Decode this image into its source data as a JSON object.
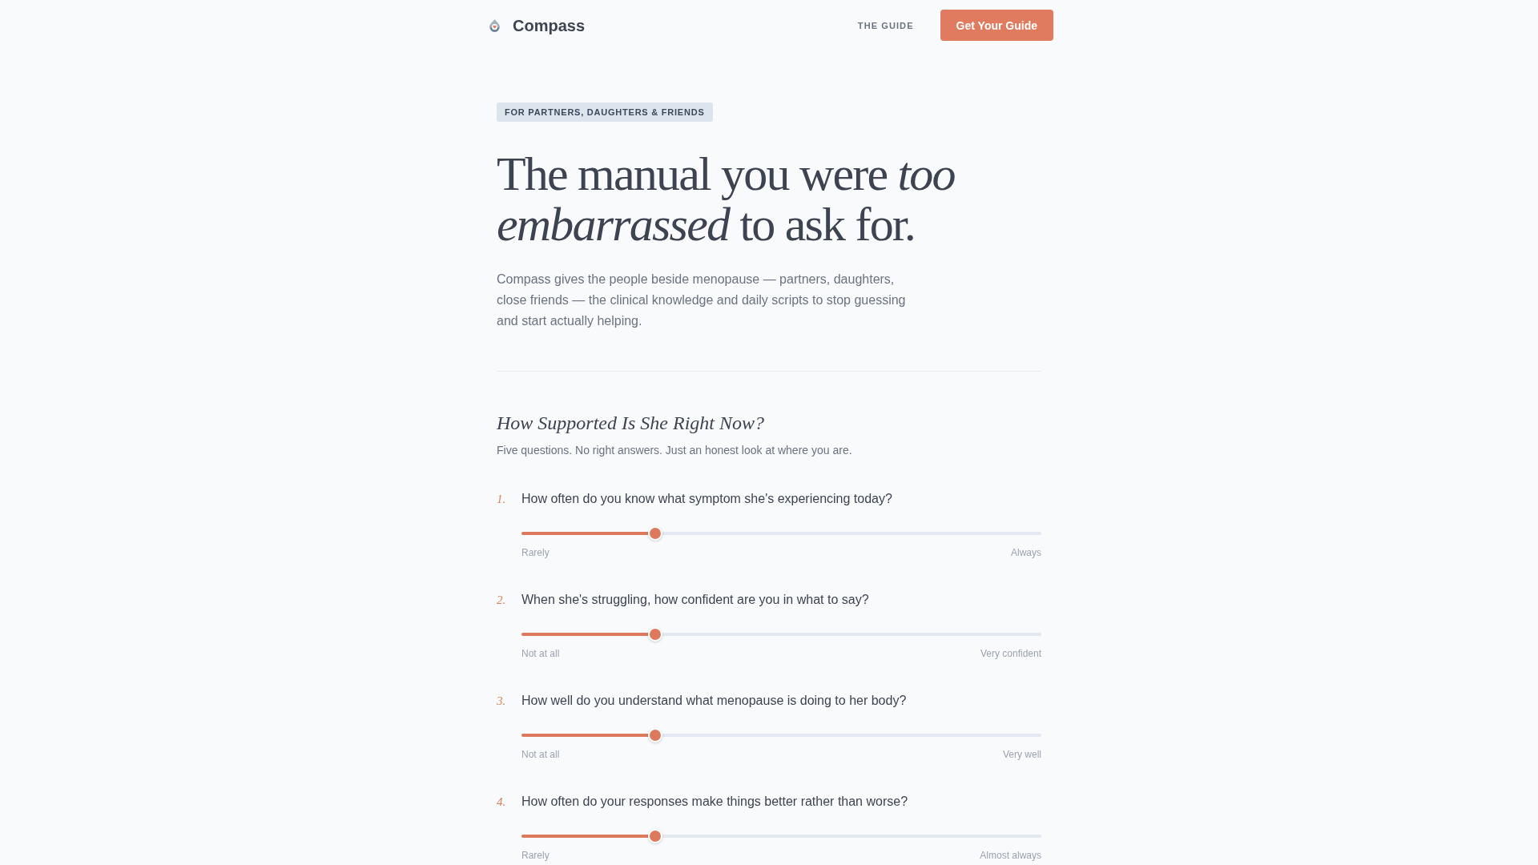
{
  "header": {
    "brand": "Compass",
    "nav": [
      {
        "label": "THE GUIDE"
      }
    ],
    "cta": "Get Your Guide"
  },
  "hero": {
    "tag": "FOR PARTNERS, DAUGHTERS & FRIENDS",
    "headline": "The manual you were *too embarrassed* to ask for.",
    "intro": "Compass gives the people beside menopause — partners, daughters, close friends — the clinical knowledge and daily scripts to stop guessing and start actually helping."
  },
  "quiz": {
    "title": "How Supported Is She Right Now?",
    "subtitle": "Five questions. No right answers. Just an honest look at where you are.",
    "questions": [
      {
        "number": "1.",
        "text": "How often do you know what symptom she's experiencing today?",
        "level": 0.25,
        "min_label": "Rarely",
        "max_label": "Always"
      },
      {
        "number": "2.",
        "text": "When she's struggling, how confident are you in what to say?",
        "level": 0.25,
        "min_label": "Not at all",
        "max_label": "Very confident"
      },
      {
        "number": "3.",
        "text": "How well do you understand what menopause is doing to her body?",
        "level": 0.25,
        "min_label": "Not at all",
        "max_label": "Very well"
      },
      {
        "number": "4.",
        "text": "How often do your responses make things better rather than worse?",
        "level": 0.25,
        "min_label": "Rarely",
        "max_label": "Almost always"
      }
    ]
  }
}
